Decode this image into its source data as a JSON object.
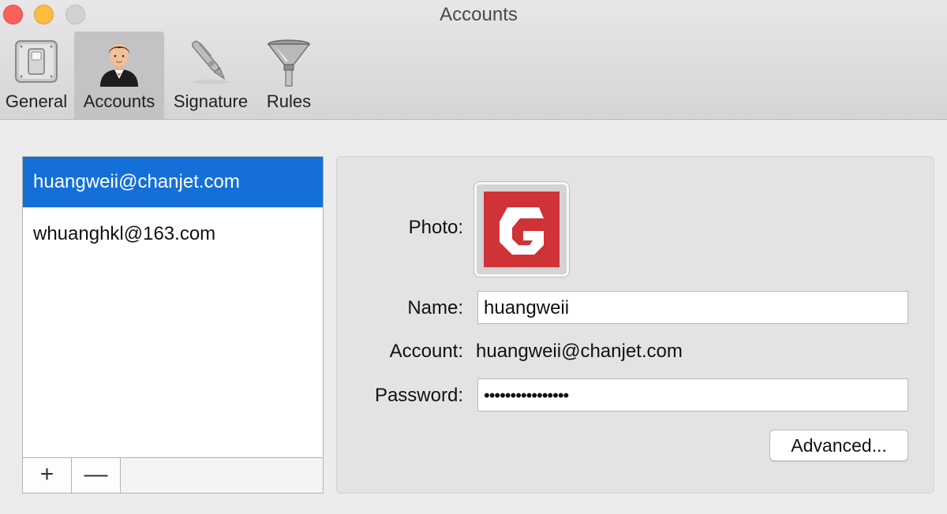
{
  "window": {
    "title": "Accounts"
  },
  "toolbar": {
    "tabs": [
      {
        "label": "General",
        "icon": "switch-icon",
        "selected": false
      },
      {
        "label": "Accounts",
        "icon": "user-avatar-icon",
        "selected": true
      },
      {
        "label": "Signature",
        "icon": "pen-icon",
        "selected": false
      },
      {
        "label": "Rules",
        "icon": "funnel-icon",
        "selected": false
      }
    ]
  },
  "accounts": {
    "items": [
      {
        "email": "huangweii@chanjet.com",
        "selected": true
      },
      {
        "email": "whuanghkl@163.com",
        "selected": false
      }
    ],
    "add_label": "+",
    "remove_label": "—"
  },
  "detail": {
    "photo_label": "Photo:",
    "name_label": "Name:",
    "name_value": "huangweii",
    "account_label": "Account:",
    "account_value": "huangweii@chanjet.com",
    "password_label": "Password:",
    "password_value": "••••••••••••••••",
    "advanced_label": "Advanced..."
  },
  "colors": {
    "selection": "#1470d8",
    "logo_red": "#cf3237",
    "close": "#fc605c",
    "minimize": "#fdbc40",
    "zoom": "#d3d1d3"
  }
}
